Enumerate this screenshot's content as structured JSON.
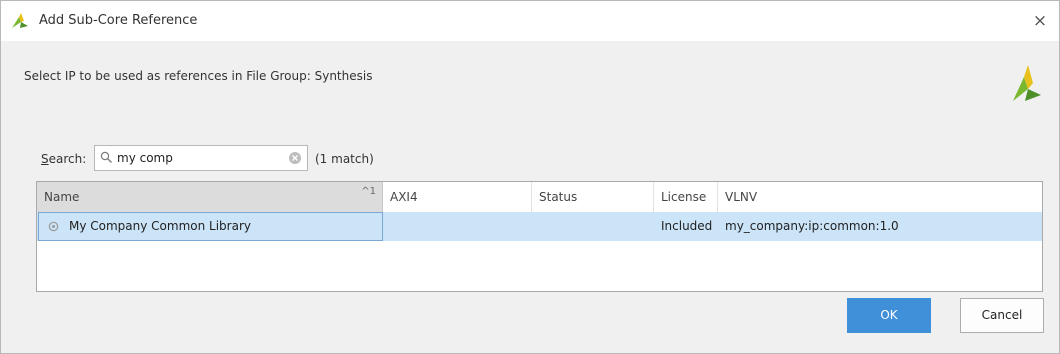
{
  "window": {
    "title": "Add Sub-Core Reference",
    "close_glyph": "×"
  },
  "instruction": "Select IP to be used as references in File Group: Synthesis",
  "search": {
    "label_first": "S",
    "label_rest": "earch:",
    "value": "my comp",
    "match_count": "(1 match)"
  },
  "table": {
    "columns": [
      "Name",
      "AXI4",
      "Status",
      "License",
      "VLNV"
    ],
    "sort_indicator": "^1",
    "rows": [
      {
        "name": "My Company Common Library",
        "axi4": "",
        "status": "",
        "license": "Included",
        "vlnv": "my_company:ip:common:1.0"
      }
    ]
  },
  "buttons": {
    "ok": "OK",
    "cancel": "Cancel"
  },
  "colors": {
    "accent": "#3f8fd9",
    "selection": "#cce4f8",
    "logo_green": "#7ab82f",
    "logo_yellow": "#e8c11a"
  },
  "icons": [
    "vivado-logo-icon",
    "close-icon",
    "search-icon",
    "clear-icon",
    "sort-ascending-icon",
    "ip-core-icon"
  ]
}
